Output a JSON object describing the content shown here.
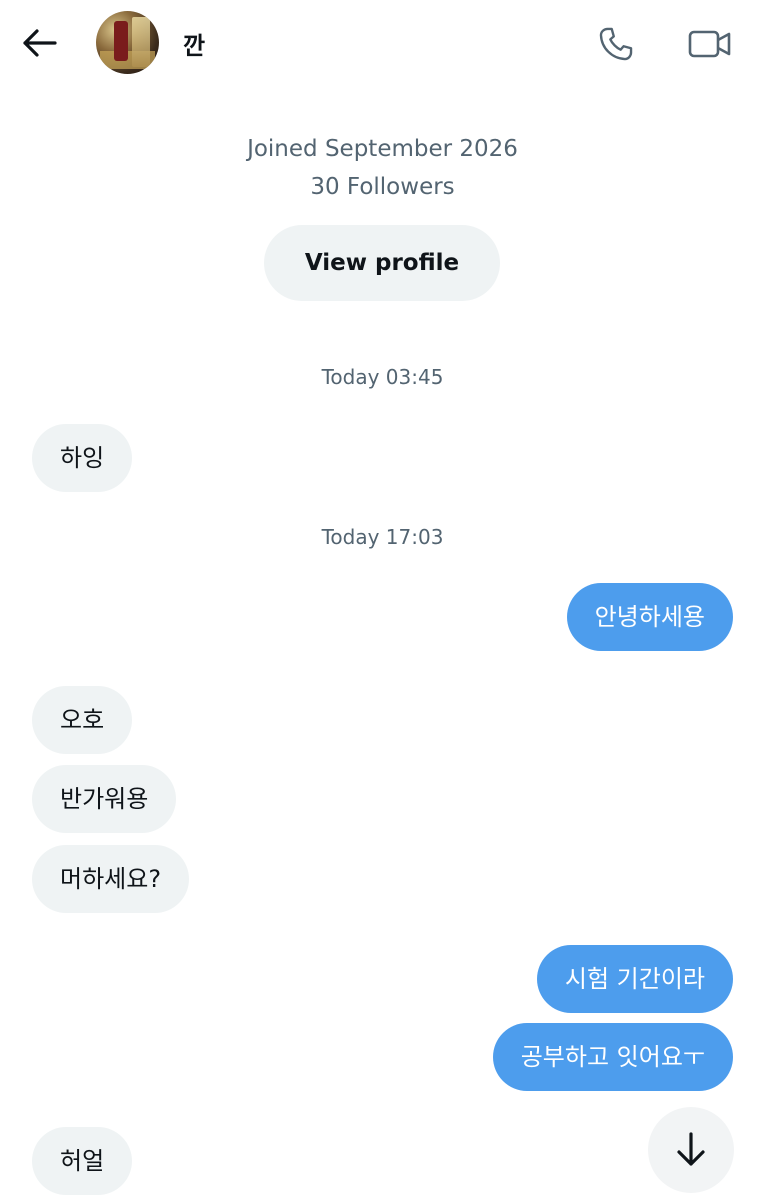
{
  "header": {
    "username": "깐",
    "icons": {
      "back": "back-arrow-icon",
      "call": "phone-icon",
      "video": "video-camera-icon"
    }
  },
  "profile": {
    "joined": "Joined September 2026",
    "followers": "30 Followers",
    "view_profile_label": "View profile"
  },
  "conversation": {
    "timestamps": [
      "Today 03:45",
      "Today 17:03"
    ],
    "messages": [
      {
        "direction": "incoming",
        "text": "하잉"
      },
      {
        "direction": "outgoing",
        "text": "안녕하세용"
      },
      {
        "direction": "incoming",
        "text": "오호"
      },
      {
        "direction": "incoming",
        "text": "반가워용"
      },
      {
        "direction": "incoming",
        "text": "머하세요?"
      },
      {
        "direction": "outgoing",
        "text": "시험 기간이라"
      },
      {
        "direction": "outgoing",
        "text": "공부하고 잇어요ㅜ"
      },
      {
        "direction": "incoming",
        "text": "허얼"
      }
    ]
  },
  "colors": {
    "outgoing_bubble": "#4d9ded",
    "incoming_bubble": "#eff3f4",
    "secondary_text": "#536471"
  },
  "scroll_button_icon": "arrow-down-icon"
}
